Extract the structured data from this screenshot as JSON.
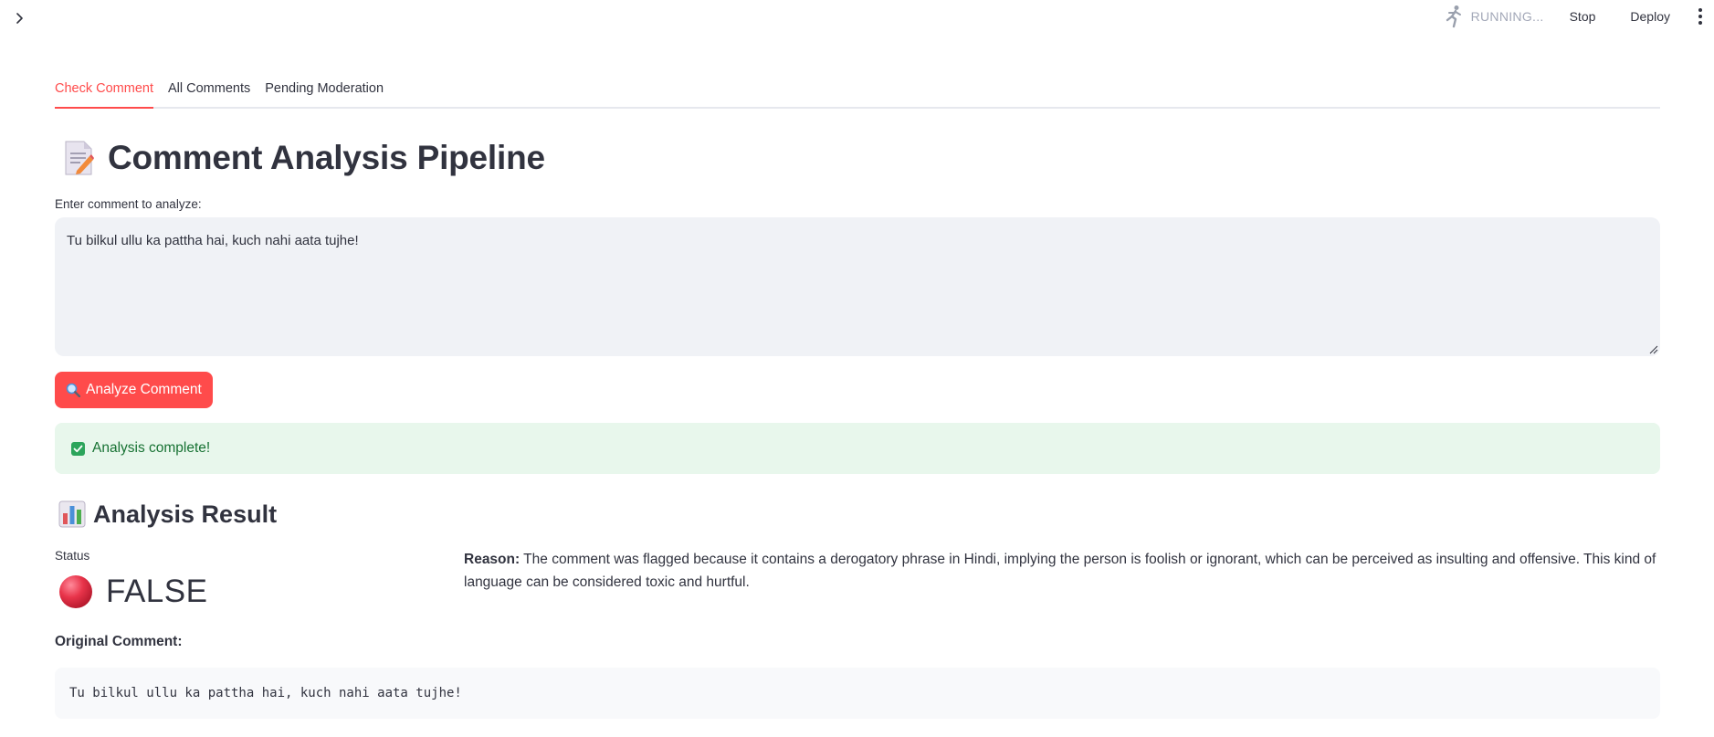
{
  "header": {
    "status_text": "RUNNING...",
    "stop_label": "Stop",
    "deploy_label": "Deploy",
    "running_icon": "running-man-icon",
    "menu_icon": "kebab-menu-icon",
    "sidebar_icon": "chevron-right-icon"
  },
  "tabs": [
    {
      "label": "Check Comment",
      "active": true
    },
    {
      "label": "All Comments",
      "active": false
    },
    {
      "label": "Pending Moderation",
      "active": false
    }
  ],
  "page": {
    "title": "Comment Analysis Pipeline",
    "title_icon": "memo-icon"
  },
  "input": {
    "label": "Enter comment to analyze:",
    "value": "Tu bilkul ullu ka pattha hai, kuch nahi aata tujhe!"
  },
  "analyze_button": {
    "label": "Analyze Comment",
    "icon": "magnifier-icon"
  },
  "alert": {
    "text": "Analysis complete!",
    "icon": "check-mark-icon"
  },
  "result": {
    "title": "Analysis Result",
    "title_icon": "bar-chart-icon",
    "status_label": "Status",
    "status_value": "FALSE",
    "status_icon": "red-circle-icon",
    "reason_label": "Reason:",
    "reason_text": " The comment was flagged because it contains a derogatory phrase in Hindi, implying the person is foolish or ignorant, which can be perceived as insulting and offensive. This kind of language can be considered toxic and hurtful.",
    "original_label": "Original Comment:",
    "original_text": "Tu bilkul ullu ka pattha hai, kuch nahi aata tujhe!"
  },
  "colors": {
    "accent": "#ff4b4b",
    "success_bg": "#e8f7ec",
    "success_text": "#177233",
    "input_bg": "#f0f2f6"
  }
}
